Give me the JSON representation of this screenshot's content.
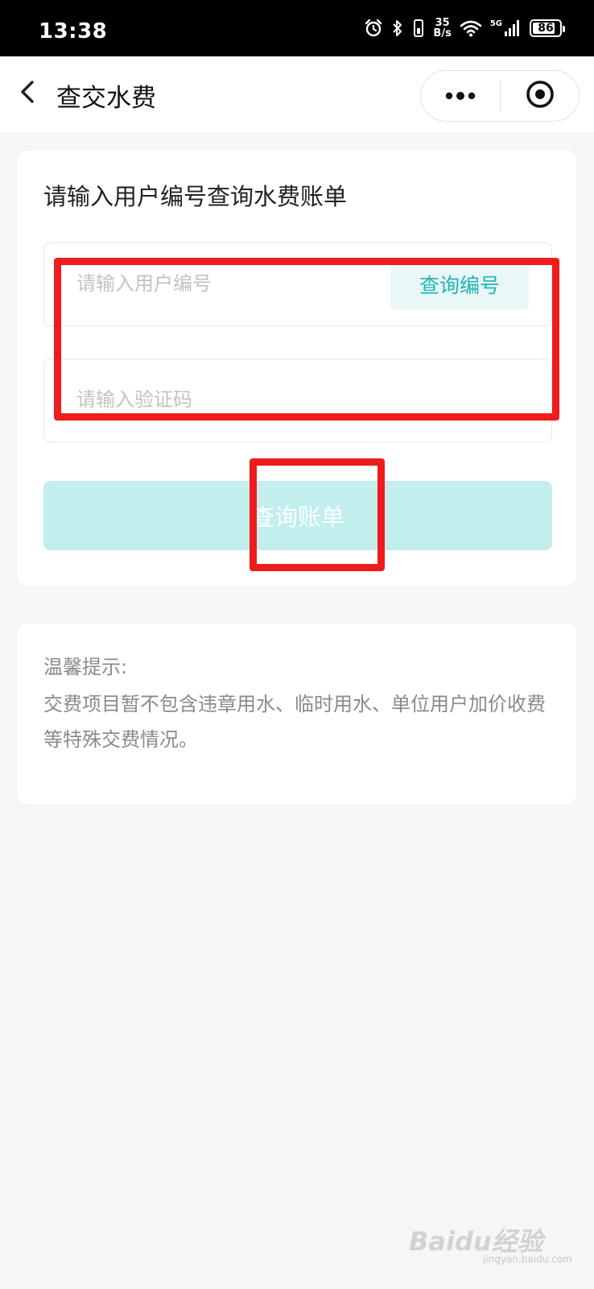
{
  "status_bar": {
    "time": "13:38",
    "net_speed_value": "35",
    "net_speed_unit": "B/s",
    "signal_label": "5G",
    "battery_level": "86",
    "icons": [
      "alarm-icon",
      "bluetooth-icon",
      "vibrate-icon",
      "wifi-icon",
      "cellular-signal-icon",
      "battery-icon"
    ]
  },
  "nav_bar": {
    "title": "查交水费",
    "back_icon": "chevron-left-icon",
    "more_icon": "more-dots-icon",
    "close_icon": "target-close-icon"
  },
  "form": {
    "heading": "请输入用户编号查询水费账单",
    "user_id_placeholder": "请输入用户编号",
    "user_id_value": "",
    "lookup_button_label": "查询编号",
    "captcha_placeholder": "请输入验证码",
    "captcha_value": "",
    "query_button_label": "查询账单",
    "accent_color": "#1fb4b8",
    "query_button_color": "#c2eeee"
  },
  "tips": {
    "title": "温馨提示:",
    "body": "交费项目暂不包含违章用水、临时用水、单位用户加价收费等特殊交费情况。"
  },
  "annotations": {
    "color": "#ee1c1c"
  },
  "watermark": {
    "text": "Baidu经验",
    "sub": "jingyan.baidu.com"
  }
}
